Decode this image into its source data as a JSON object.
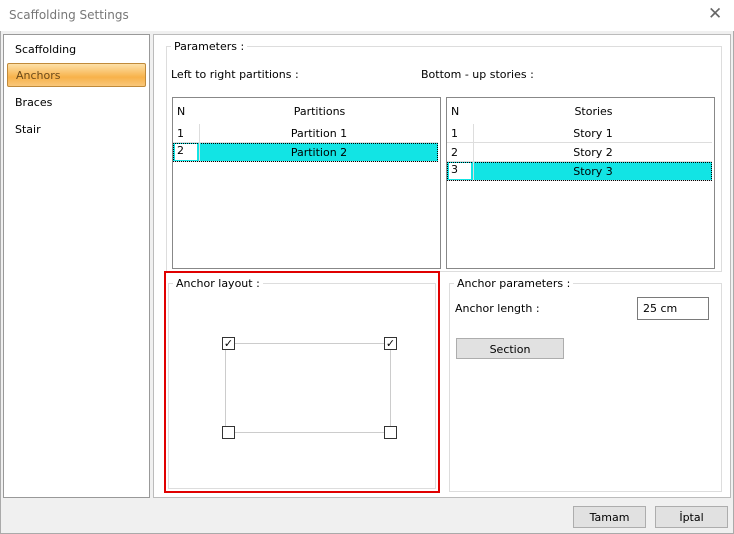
{
  "window": {
    "title": "Scaffolding Settings"
  },
  "sidebar": {
    "items": [
      {
        "label": "Scaffolding"
      },
      {
        "label": "Anchors",
        "selected": true
      },
      {
        "label": "Braces"
      },
      {
        "label": "Stair"
      }
    ]
  },
  "parameters": {
    "legend": "Parameters :",
    "partitions_label": "Left to right partitions :",
    "stories_label": "Bottom - up stories :"
  },
  "partitions_table": {
    "columns": [
      "N",
      "Partitions"
    ],
    "rows": [
      {
        "n": "1",
        "name": "Partition 1"
      },
      {
        "n": "2",
        "name": "Partition 2",
        "selected": true
      }
    ]
  },
  "stories_table": {
    "columns": [
      "N",
      "Stories"
    ],
    "rows": [
      {
        "n": "1",
        "name": "Story 1"
      },
      {
        "n": "2",
        "name": "Story 2"
      },
      {
        "n": "3",
        "name": "Story 3",
        "selected": true
      }
    ]
  },
  "anchor_layout": {
    "legend": "Anchor layout :",
    "checkboxes": {
      "top_left": true,
      "top_right": true,
      "bottom_left": false,
      "bottom_right": false
    },
    "check_glyph": "✓",
    "highlight_color": "#e00000"
  },
  "anchor_parameters": {
    "legend": "Anchor parameters :",
    "length_label": "Anchor length :",
    "length_value": "25 cm",
    "section_button": "Section"
  },
  "footer": {
    "ok": "Tamam",
    "cancel": "İptal"
  },
  "colors": {
    "selection": "#12e4e4",
    "accent": "#f8b24a"
  }
}
